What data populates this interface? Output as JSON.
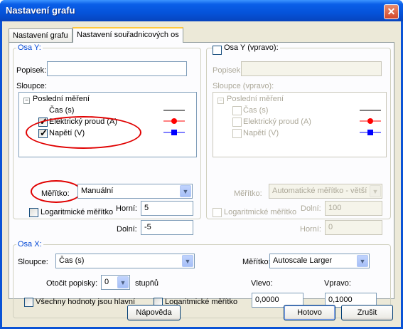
{
  "window": {
    "title": "Nastavení grafu"
  },
  "tabs": [
    {
      "label": "Nastavení grafu"
    },
    {
      "label": "Nastavení souřadnicových os"
    }
  ],
  "axis_y": {
    "legend": "Osa Y:",
    "label_caption": "Popisek:",
    "label_value": "",
    "columns_caption": "Sloupce:",
    "tree_root": "Poslední měření",
    "items": [
      {
        "label": "Čas (s)"
      },
      {
        "label": "Elektrický proud (A)"
      },
      {
        "label": "Napětí (V)"
      }
    ],
    "scale_label": "Měřítko:",
    "scale_value": "Manuální",
    "log_label": "Logaritmické měřítko",
    "upper_label": "Horní:",
    "upper_value": "5",
    "lower_label": "Dolní:",
    "lower_value": "-5"
  },
  "axis_y_right": {
    "legend": "Osa Y (vpravo):",
    "label_caption": "Popisek:",
    "label_value": "",
    "columns_caption": "Sloupce (vpravo):",
    "tree_root": "Poslední měření",
    "items": [
      {
        "label": "Čas (s)"
      },
      {
        "label": "Elektrický proud (A)"
      },
      {
        "label": "Napětí (V)"
      }
    ],
    "scale_label": "Měřítko:",
    "scale_value": "Automatické měřítko - větší",
    "log_label": "Logaritmické měřítko",
    "lower_label": "Dolní:",
    "lower_value": "100",
    "upper_label": "Horní:",
    "upper_value": "0"
  },
  "axis_x": {
    "legend": "Osa X:",
    "column_label": "Sloupce:",
    "column_value": "Čas (s)",
    "scale_label": "Měřítko:",
    "scale_value": "Autoscale Larger",
    "rotate_label": "Otočit popisky:",
    "rotate_value": "0",
    "rotate_unit": "stupňů",
    "left_label": "Vlevo:",
    "left_value": "0,0000",
    "right_label": "Vpravo:",
    "right_value": "0,1000",
    "all_values_label": "Všechny hodnoty jsou hlavní",
    "log_label": "Logaritmické měřítko"
  },
  "buttons": {
    "help": "Nápověda",
    "ok": "Hotovo",
    "cancel": "Zrušit"
  },
  "colors": {
    "series_time": "#000000",
    "series_current": "#ff0000",
    "series_voltage": "#0000ff",
    "highlight": "#e00000"
  }
}
